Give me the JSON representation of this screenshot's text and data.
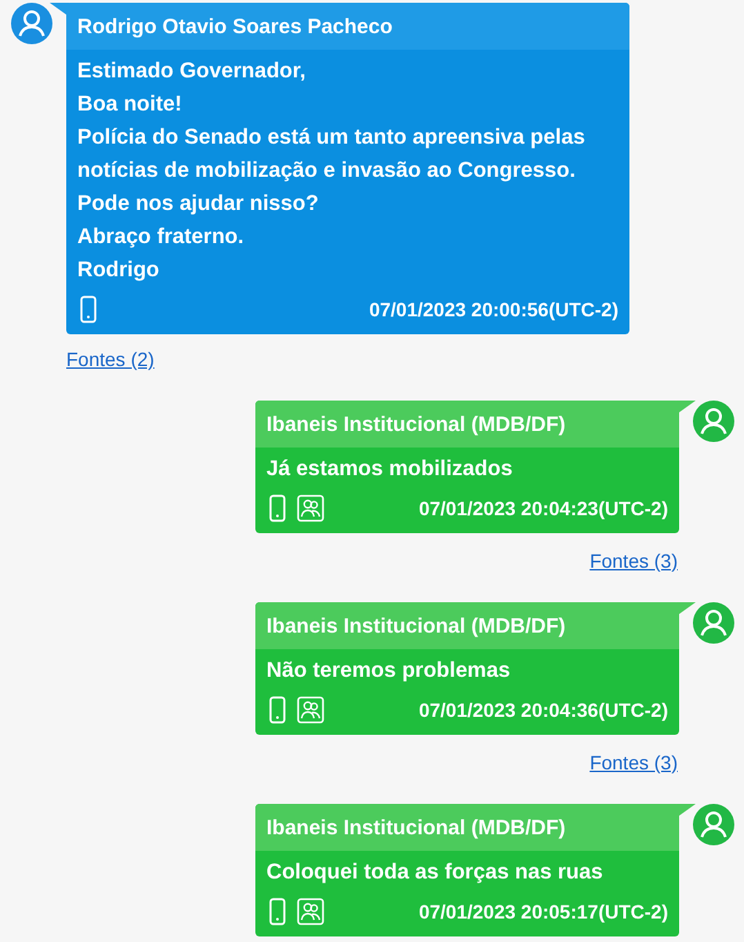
{
  "messages": [
    {
      "kind": "incoming",
      "sender": "Rodrigo Otavio Soares Pacheco",
      "lines": [
        "Estimado Governador,",
        "Boa noite!",
        "Polícia do Senado está um tanto apreensiva pelas",
        "notícias de mobilização e invasão ao Congresso.",
        "Pode nos ajudar nisso?",
        "Abraço fraterno.",
        "Rodrigo"
      ],
      "icons": [
        {
          "kind": "phone"
        }
      ],
      "timestamp": "07/01/2023 20:00:56(UTC-2)",
      "sources": "Fontes (2)"
    },
    {
      "kind": "outgoing",
      "sender": "Ibaneis Institucional (MDB/DF)",
      "lines": [
        "Já estamos mobilizados"
      ],
      "icons": [
        {
          "kind": "phone"
        },
        {
          "kind": "group"
        }
      ],
      "timestamp": "07/01/2023 20:04:23(UTC-2)",
      "sources": "Fontes (3)"
    },
    {
      "kind": "outgoing",
      "sender": "Ibaneis Institucional (MDB/DF)",
      "lines": [
        "Não teremos problemas"
      ],
      "icons": [
        {
          "kind": "phone"
        },
        {
          "kind": "group"
        }
      ],
      "timestamp": "07/01/2023 20:04:36(UTC-2)",
      "sources": "Fontes (3)"
    },
    {
      "kind": "outgoing",
      "sender": "Ibaneis Institucional (MDB/DF)",
      "lines": [
        "Coloquei toda as forças nas ruas"
      ],
      "icons": [
        {
          "kind": "phone"
        },
        {
          "kind": "group"
        }
      ],
      "timestamp": "07/01/2023 20:05:17(UTC-2)"
    }
  ]
}
